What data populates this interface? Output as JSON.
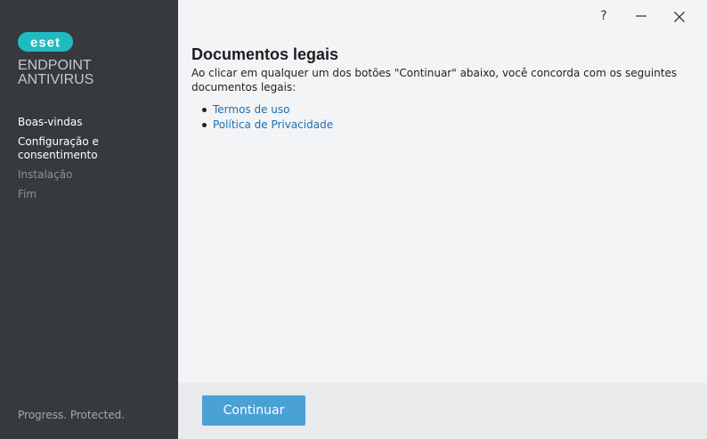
{
  "brand": {
    "logo_text": "eset",
    "product_line1": "ENDPOINT",
    "product_line2": "ANTIVIRUS",
    "tagline": "Progress. Protected.",
    "accent": "#1fbbc1"
  },
  "steps": [
    {
      "label": "Boas-vindas",
      "state": "done"
    },
    {
      "label": "Configuração e\nconsentimento",
      "state": "current"
    },
    {
      "label": "Instalação",
      "state": "pending"
    },
    {
      "label": "Fim",
      "state": "pending"
    }
  ],
  "window": {
    "help_label": "?",
    "minimize_icon": "minimize-icon",
    "close_icon": "close-icon"
  },
  "main": {
    "title": "Documentos legais",
    "description": "Ao clicar em qualquer um dos botões \"Continuar\" abaixo, você concorda com os seguintes documentos legais:",
    "links": [
      {
        "label": "Termos de uso"
      },
      {
        "label": "Política de Privacidade"
      }
    ],
    "link_color": "#1e6fae"
  },
  "footer": {
    "continue_label": "Continuar",
    "button_color": "#4aa1d6"
  }
}
